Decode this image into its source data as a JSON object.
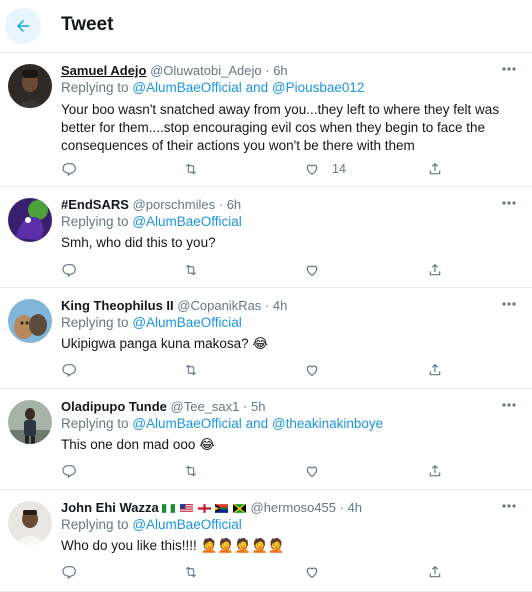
{
  "header": {
    "title": "Tweet",
    "back_icon": "arrow-left-icon",
    "accent": "#1da1f2"
  },
  "replying_to_label": "Replying to",
  "and_label": "and",
  "dot": "·",
  "tweets": [
    {
      "name": "Samuel Adejo",
      "handle": "@Oluwatobi_Adejo",
      "time": "6h",
      "mentions": [
        "@AlumBaeOfficial",
        "@Piousbae012"
      ],
      "text": "Your boo wasn't snatched away from you...they left to where they felt was better for them....stop encouraging evil cos when they begin to face the consequences of their actions you won't be there with them",
      "like_count": "14"
    },
    {
      "name": "#EndSARS",
      "handle": "@porschmiles",
      "time": "6h",
      "mentions": [
        "@AlumBaeOfficial"
      ],
      "text": "Smh, who did this to you?"
    },
    {
      "name": "King Theophilus II",
      "handle": "@CopanikRas",
      "time": "4h",
      "mentions": [
        "@AlumBaeOfficial"
      ],
      "text": "Ukipigwa panga kuna makosa? 😂"
    },
    {
      "name": "Oladipupo Tunde",
      "handle": "@Tee_sax1",
      "time": "5h",
      "mentions": [
        "@AlumBaeOfficial",
        "@theakinakinboye"
      ],
      "text": "This one don mad ooo 😂"
    },
    {
      "name": "John Ehi Wazza",
      "name_flags": [
        "nigeria-flag",
        "usa-flag",
        "england-flag",
        "south-africa-flag",
        "jamaica-flag"
      ],
      "handle": "@hermoso455",
      "time": "4h",
      "mentions": [
        "@AlumBaeOfficial"
      ],
      "text": "Who do you like this!!!! 🤦🤦🤦🤦🤦"
    }
  ],
  "action_icons": [
    "reply-icon",
    "retweet-icon",
    "like-icon",
    "share-icon"
  ],
  "colors": {
    "text": "#14171a",
    "muted": "#657786",
    "link": "#1b95e0",
    "border": "#e6ecf0"
  }
}
